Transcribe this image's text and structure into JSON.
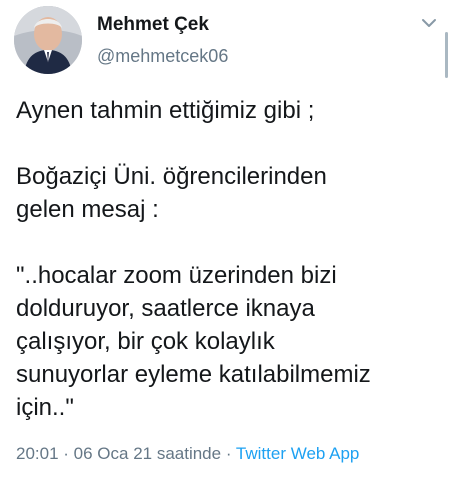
{
  "author": {
    "name": "Mehmet Çek",
    "handle": "@mehmetcek06"
  },
  "tweet": {
    "lines": [
      "Aynen tahmin ettiğimiz gibi ;",
      "",
      "Boğaziçi Üni. öğrencilerinden",
      "gelen mesaj :",
      "",
      "\"..hocalar zoom üzerinden bizi",
      "dolduruyor, saatlerce iknaya",
      "çalışıyor, bir çok kolaylık",
      "sunuyorlar eyleme katılabilmemiz",
      "için..\""
    ]
  },
  "meta": {
    "time": "20:01",
    "separator1": " · ",
    "date": "06 Oca 21 saatinde",
    "separator2": " · ",
    "source": "Twitter Web App"
  },
  "icons": {
    "caret": "chevron-down-icon",
    "avatar": "avatar"
  },
  "colors": {
    "text": "#14171a",
    "secondary": "#657786",
    "link": "#1da1f2"
  }
}
